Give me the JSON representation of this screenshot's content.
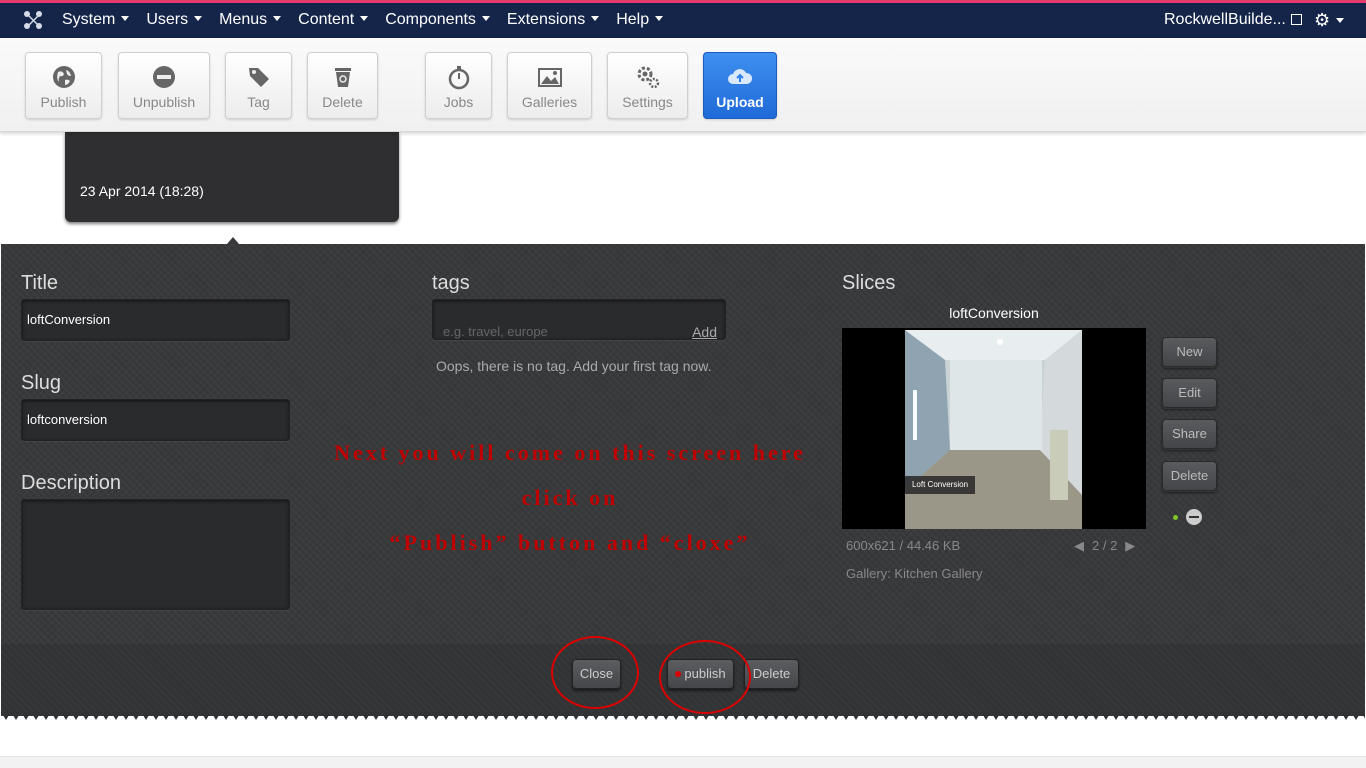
{
  "topnav": {
    "menu": [
      "System",
      "Users",
      "Menus",
      "Content",
      "Components",
      "Extensions",
      "Help"
    ],
    "site_name": "RockwellBuilde..."
  },
  "toolbar": {
    "publish": "Publish",
    "unpublish": "Unpublish",
    "tag": "Tag",
    "delete": "Delete",
    "jobs": "Jobs",
    "galleries": "Galleries",
    "settings": "Settings",
    "upload": "Upload"
  },
  "card": {
    "date": "23 Apr 2014 (18:28)"
  },
  "form": {
    "title_label": "Title",
    "title_value": "loftConversion",
    "slug_label": "Slug",
    "slug_value": "loftconversion",
    "description_label": "Description",
    "tags_label": "tags",
    "tags_placeholder": "e.g. travel, europe",
    "tags_add": "Add",
    "no_tag_text": "Oops, there is no tag. Add your first tag now."
  },
  "overlay": {
    "line1": "Next you will come on this screen here click on",
    "line2": "“Publish” button and “cloxe”"
  },
  "slices": {
    "label": "Slices",
    "name": "loftConversion",
    "image_caption": "Loft Conversion",
    "meta": "600x621 / 44.46 KB",
    "page": "2 / 2",
    "gallery": "Gallery: Kitchen Gallery",
    "buttons": {
      "new": "New",
      "edit": "Edit",
      "share": "Share",
      "delete": "Delete"
    }
  },
  "footer": {
    "close": "Close",
    "publish": "publish",
    "delete": "Delete"
  },
  "colors": {
    "nav": "#15254a",
    "accent_top": "#e23a6f",
    "upload": "#2f7fe8",
    "annotation": "#d00000"
  }
}
